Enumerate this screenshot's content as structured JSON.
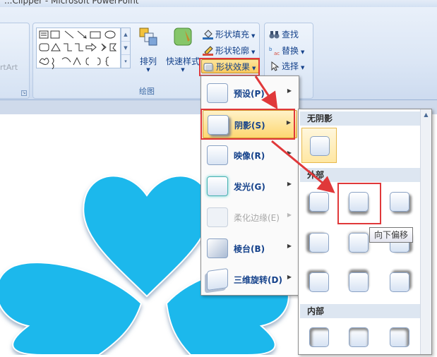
{
  "window": {
    "title": "...Clipper - Microsoft PowerPoint"
  },
  "ribbon": {
    "left_group_text": "rtArt",
    "drawing_group_label": "绘图",
    "arrange_label": "排列",
    "quick_styles_label": "快速样式",
    "shape_fill_label": "形状填充",
    "shape_outline_label": "形状轮廓",
    "shape_effects_label": "形状效果",
    "find_label": "查找",
    "replace_label": "替换",
    "select_label": "选择"
  },
  "effects_menu": {
    "items": [
      {
        "label": "预设(P)",
        "enabled": true
      },
      {
        "label": "阴影(S)",
        "enabled": true
      },
      {
        "label": "映像(R)",
        "enabled": true
      },
      {
        "label": "发光(G)",
        "enabled": true
      },
      {
        "label": "柔化边缘(E)",
        "enabled": false
      },
      {
        "label": "棱台(B)",
        "enabled": true
      },
      {
        "label": "三维旋转(D)",
        "enabled": true
      }
    ],
    "highlighted_index": 1
  },
  "shadow_submenu": {
    "sections": [
      {
        "label": "无阴影"
      },
      {
        "label": "外部"
      },
      {
        "label": "内部"
      }
    ],
    "tooltip": "向下偏移"
  },
  "colors": {
    "accent_red": "#e0383a",
    "shape_blue": "#1fb8ec",
    "highlight": "#fdd771"
  }
}
